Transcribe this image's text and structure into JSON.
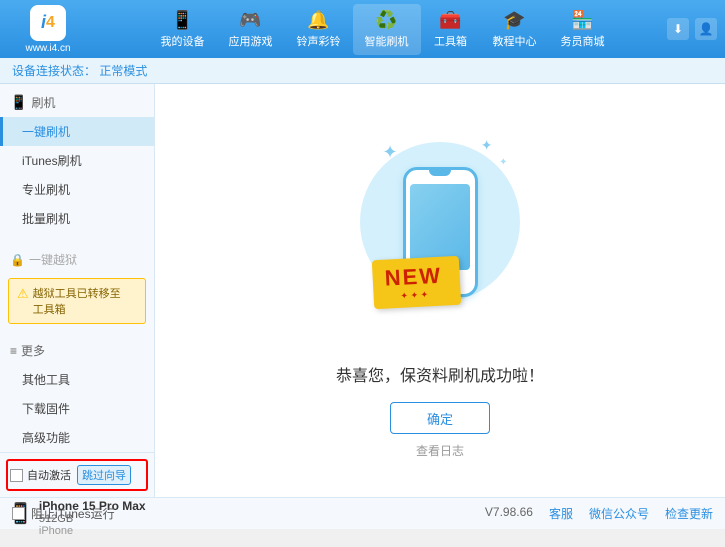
{
  "app": {
    "logo_text": "www.i4.cn",
    "logo_char": "i4"
  },
  "topbar": {
    "nav_items": [
      {
        "id": "my-device",
        "icon": "📱",
        "label": "我的设备"
      },
      {
        "id": "apps-games",
        "icon": "🎮",
        "label": "应用游戏"
      },
      {
        "id": "ringtone",
        "icon": "🔔",
        "label": "铃声彩铃"
      },
      {
        "id": "smart-flash",
        "icon": "♻️",
        "label": "智能刷机",
        "active": true
      },
      {
        "id": "toolbox",
        "icon": "🧰",
        "label": "工具箱"
      },
      {
        "id": "tutorials",
        "icon": "🎓",
        "label": "教程中心"
      },
      {
        "id": "service",
        "icon": "🏪",
        "label": "务员商城"
      }
    ],
    "btn_download": "⬇",
    "btn_user": "👤"
  },
  "statusbar": {
    "prefix": "设备连接状态：",
    "status": "正常模式"
  },
  "sidebar": {
    "group_flash": {
      "icon": "📱",
      "label": "刷机"
    },
    "flash_items": [
      {
        "id": "one-key-flash",
        "label": "一键刷机",
        "active": true
      },
      {
        "id": "itunes-flash",
        "label": "iTunes刷机"
      },
      {
        "id": "pro-flash",
        "label": "专业刷机"
      },
      {
        "id": "batch-flash",
        "label": "批量刷机"
      }
    ],
    "jailbreak_header": "一键越狱",
    "jailbreak_disabled": true,
    "notice_text": "越狱工具已转移至\n工具箱",
    "more_label": "更多",
    "more_items": [
      {
        "id": "other-tools",
        "label": "其他工具"
      },
      {
        "id": "download-fw",
        "label": "下载固件"
      },
      {
        "id": "advanced",
        "label": "高级功能"
      }
    ],
    "auto_activate_label": "自动激活",
    "auto_guide_label": "跳过向导",
    "device": {
      "icon": "📱",
      "name": "iPhone 15 Pro Max",
      "storage": "512GB",
      "type": "iPhone"
    }
  },
  "content": {
    "new_label": "NEW",
    "success_text": "恭喜您，保资料刷机成功啦！",
    "confirm_label": "确定",
    "log_label": "查看日志"
  },
  "footer": {
    "stop_itunes_label": "阻止iTunes运行",
    "version": "V7.98.66",
    "client_label": "客服",
    "wechat_label": "微信公众号",
    "check_update_label": "检查更新"
  }
}
